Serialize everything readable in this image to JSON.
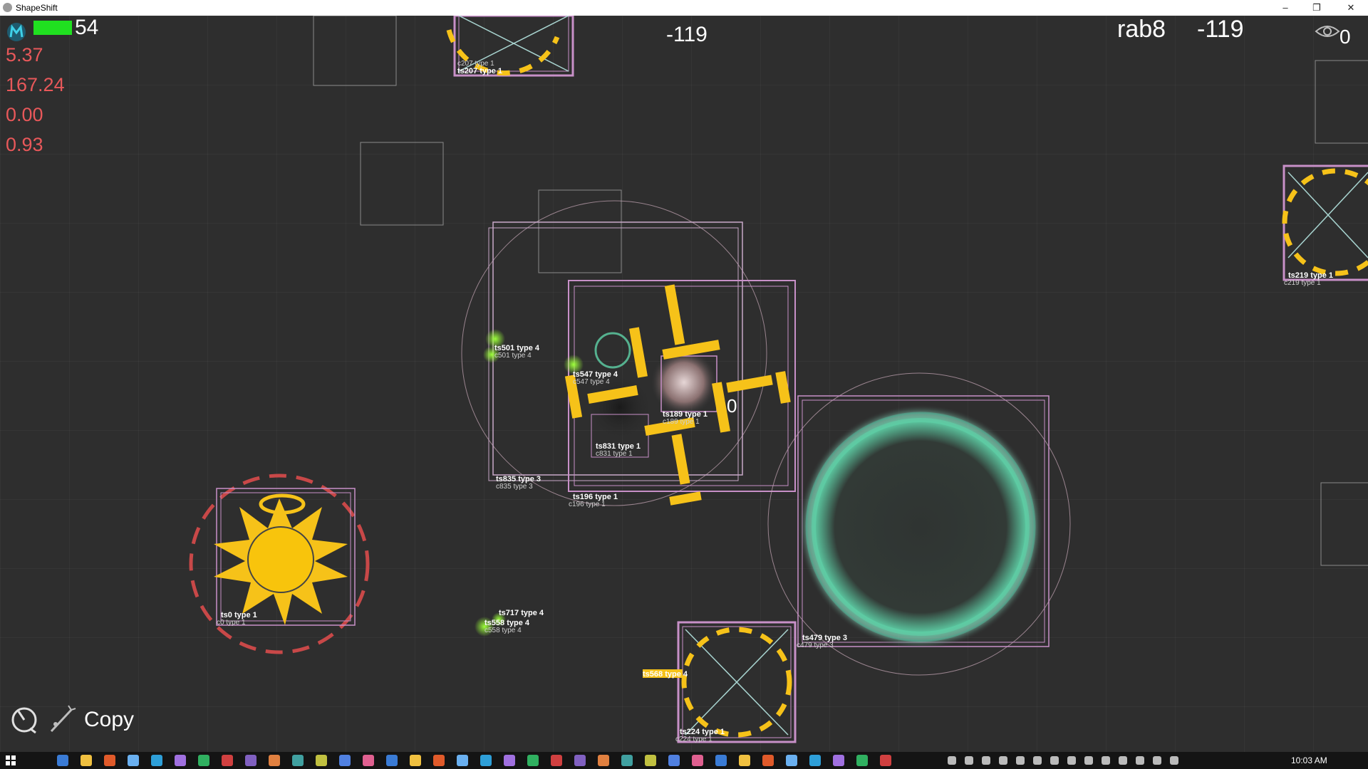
{
  "window": {
    "title": "ShapeShift",
    "minimize_label": "–",
    "maximize_label": "❐",
    "close_label": "✕"
  },
  "hud": {
    "health_value": "54",
    "health_fraction": 1.0,
    "health_color": "#20e020",
    "stats": [
      "5.37",
      "167.24",
      "0.00",
      "0.93"
    ],
    "stat_color": "#e8585a",
    "center_score": "-119",
    "player_name": "rab8",
    "player_score": "-119",
    "spectator_count": "0",
    "tool_label": "Copy",
    "icons": {
      "player": "player-m-icon",
      "spectator": "eye-icon",
      "tool_1": "timer-hand-icon",
      "tool_2": "copy-wand-icon"
    }
  },
  "entities": {
    "labels": [
      "ts501 type 4",
      "c501 type 4",
      "ts547 type 4",
      "c547 type 4",
      "ts189 type 1",
      "c189 type 1",
      "ts831 type 1",
      "c831 type 1",
      "ts835 type 3",
      "c835 type 3",
      "ts196 type 1",
      "c196 type 1",
      "ts0 type 1",
      "c0 type 1",
      "ts717 type 4",
      "ts558 type 4",
      "c558 type 4",
      "ts479 type 3",
      "c479 type 3",
      "ts224 type 1",
      "c224 type 1",
      "c207 type 1",
      "ts207 type 1",
      "ts219 type 1",
      "c219 type 1",
      "ts568 type 4"
    ],
    "floating_zero": "0",
    "colors": {
      "gold": "#f6c219",
      "pink_box": "#c890c8",
      "portal": "#5fd2a8",
      "danger_ring": "#c84848"
    }
  },
  "taskbar": {
    "clock": "10:03 AM"
  }
}
